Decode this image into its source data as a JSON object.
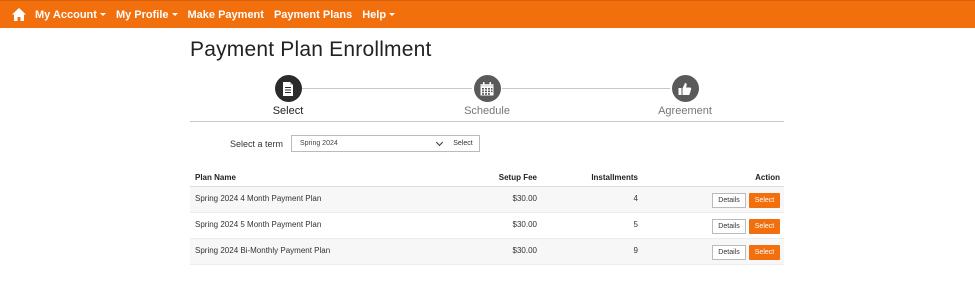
{
  "nav": {
    "home_icon": "home-icon",
    "items": [
      {
        "label": "My Account",
        "dropdown": true
      },
      {
        "label": "My Profile",
        "dropdown": true
      },
      {
        "label": "Make Payment",
        "dropdown": false
      },
      {
        "label": "Payment Plans",
        "dropdown": false
      },
      {
        "label": "Help",
        "dropdown": true
      }
    ]
  },
  "page": {
    "title": "Payment Plan Enrollment"
  },
  "stepper": {
    "steps": [
      {
        "label": "Select",
        "icon": "document-icon",
        "state": "active"
      },
      {
        "label": "Schedule",
        "icon": "calendar-icon",
        "state": "inactive"
      },
      {
        "label": "Agreement",
        "icon": "thumbs-up-icon",
        "state": "inactive"
      }
    ]
  },
  "term": {
    "label": "Select a term",
    "selected": "Spring 2024",
    "button": "Select"
  },
  "table": {
    "headers": {
      "name": "Plan Name",
      "fee": "Setup Fee",
      "installments": "Installments",
      "action": "Action"
    },
    "rows": [
      {
        "name": "Spring 2024 4 Month Payment Plan",
        "fee": "$30.00",
        "installments": "4",
        "details": "Details",
        "select": "Select"
      },
      {
        "name": "Spring 2024 5 Month Payment Plan",
        "fee": "$30.00",
        "installments": "5",
        "details": "Details",
        "select": "Select"
      },
      {
        "name": "Spring 2024 Bi-Monthly Payment Plan",
        "fee": "$30.00",
        "installments": "9",
        "details": "Details",
        "select": "Select"
      }
    ]
  },
  "colors": {
    "accent": "#f26f0d",
    "step_active": "#2b2b2b",
    "step_inactive": "#5a5a5a"
  }
}
